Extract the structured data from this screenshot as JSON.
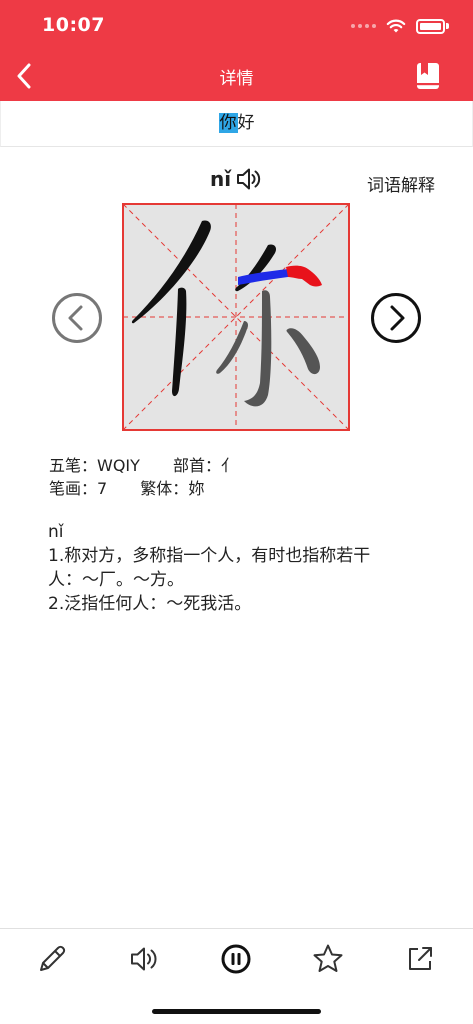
{
  "status": {
    "time": "10:07"
  },
  "nav": {
    "title": "详情",
    "back_icon": "chevron-left-icon",
    "book_icon": "bookmark-book-icon"
  },
  "word": {
    "highlight": "你",
    "rest": "好"
  },
  "pinyin": "nǐ",
  "explain_link": "词语解释",
  "character": "你",
  "info": {
    "wubi_label": "五笔：",
    "wubi": "WQIY",
    "radical_label": "部首：",
    "radical": "亻",
    "strokes_label": "笔画：",
    "strokes": "7",
    "traditional_label": "繁体：",
    "traditional": "妳"
  },
  "definition": {
    "pinyin": "nǐ",
    "lines": [
      "1.称对方，多称指一个人，有时也指称若干",
      "人：～厂。～方。",
      "2.泛指任何人：～死我活。"
    ]
  },
  "toolbar": [
    "pencil-icon",
    "speaker-icon",
    "pause-icon",
    "star-icon",
    "share-icon"
  ],
  "colors": {
    "header": "#EE3A45",
    "highlight": "#2FA6E6",
    "grid": "#E53935",
    "stroke_active": "#1E2BE8"
  }
}
